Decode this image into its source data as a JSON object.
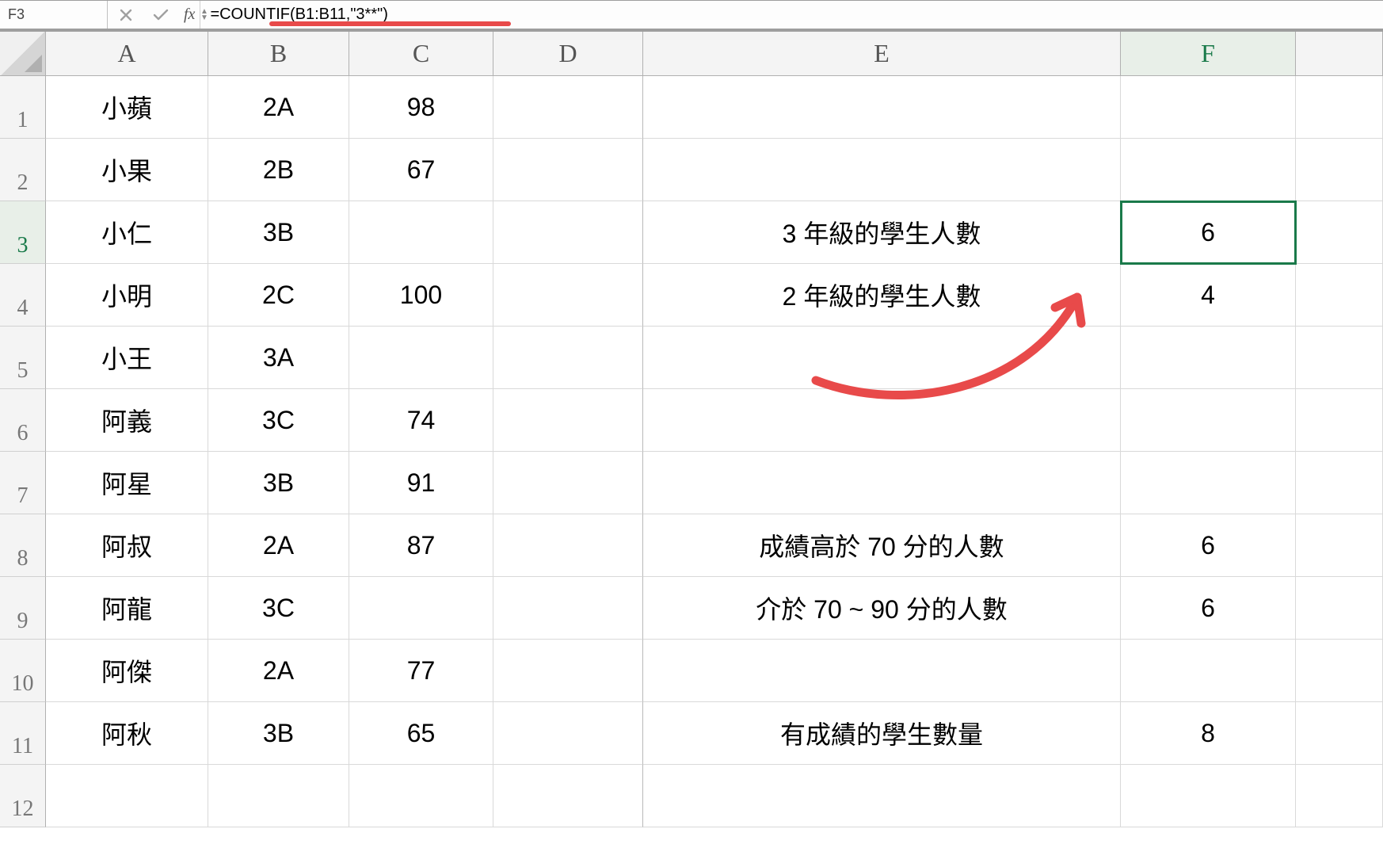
{
  "formula_bar": {
    "name_box": "F3",
    "fx_label": "fx",
    "formula": "=COUNTIF(B1:B11,\"3**\")"
  },
  "columns": [
    "A",
    "B",
    "C",
    "D",
    "E",
    "F"
  ],
  "selected_cell": "F3",
  "row_count": 12,
  "active_col": "F",
  "active_row": 3,
  "cells": {
    "A1": "小蘋",
    "B1": "2A",
    "C1": "98",
    "A2": "小果",
    "B2": "2B",
    "C2": "67",
    "A3": "小仁",
    "B3": "3B",
    "E3": "3 年級的學生人數",
    "F3": "6",
    "A4": "小明",
    "B4": "2C",
    "C4": "100",
    "E4": "2 年級的學生人數",
    "F4": "4",
    "A5": "小王",
    "B5": "3A",
    "A6": "阿義",
    "B6": "3C",
    "C6": "74",
    "A7": "阿星",
    "B7": "3B",
    "C7": "91",
    "A8": "阿叔",
    "B8": "2A",
    "C8": "87",
    "E8": "成績高於 70 分的人數",
    "F8": "6",
    "A9": "阿龍",
    "B9": "3C",
    "E9": "介於 70 ~ 90 分的人數",
    "F9": "6",
    "A10": "阿傑",
    "B10": "2A",
    "C10": "77",
    "A11": "阿秋",
    "B11": "3B",
    "C11": "65",
    "E11": "有成績的學生數量",
    "F11": "8"
  },
  "annotation": {
    "color": "#e84a4a"
  }
}
